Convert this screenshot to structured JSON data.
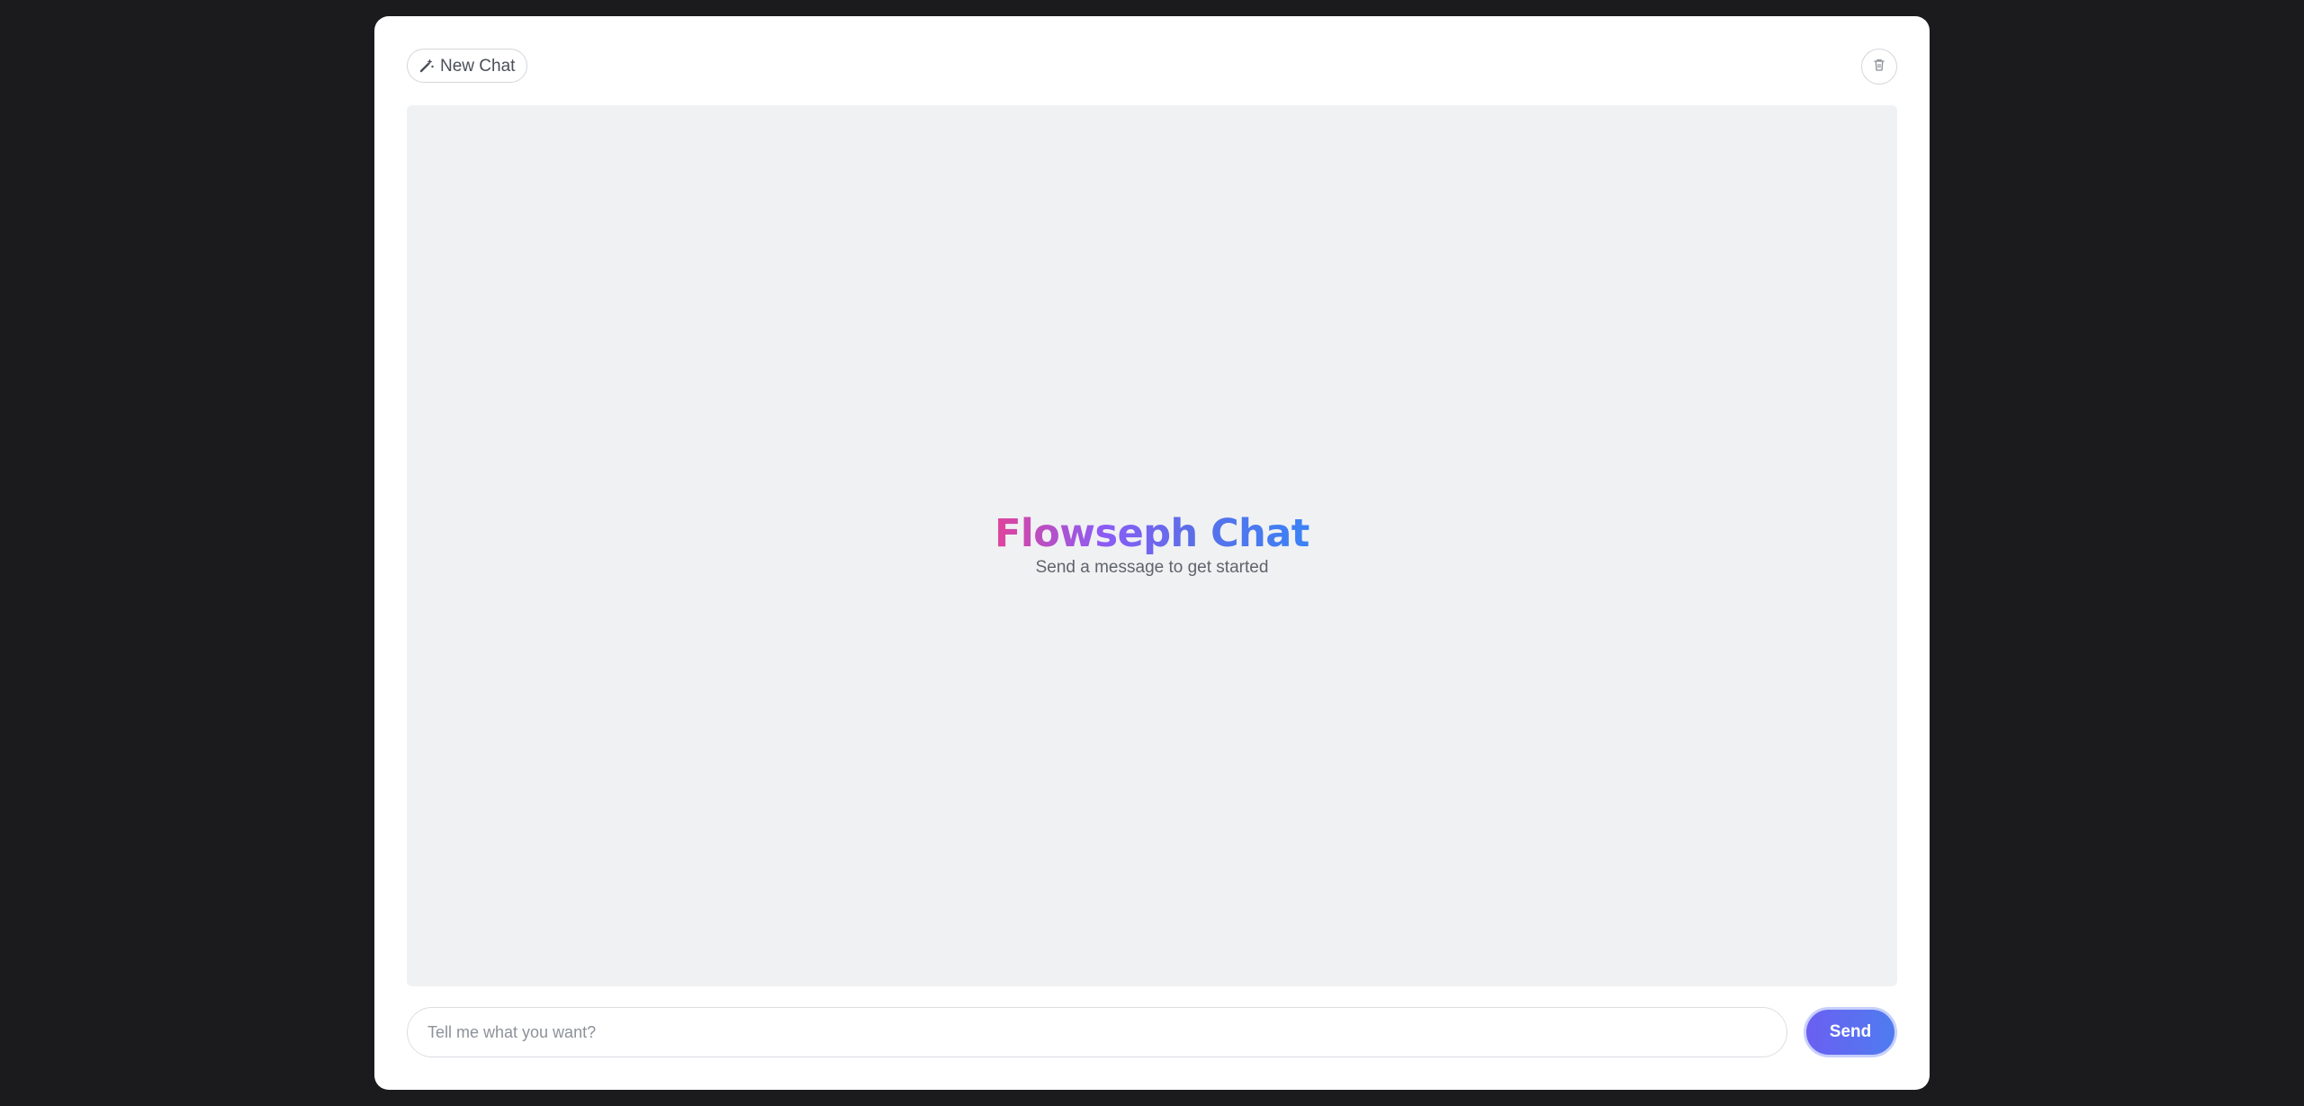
{
  "header": {
    "new_chat_label": "New Chat",
    "new_chat_icon": "magic-wand-icon",
    "clear_icon": "trash-icon"
  },
  "chat": {
    "title": "Flowseph Chat",
    "subtitle": "Send a message to get started"
  },
  "composer": {
    "placeholder": "Tell me what you want?",
    "value": "",
    "send_label": "Send"
  },
  "colors": {
    "background": "#1b1b1d",
    "card": "#ffffff",
    "chat_area": "#f0f1f3",
    "title_gradient": [
      "#e0439a",
      "#8b5cf6",
      "#3b82f6"
    ],
    "send_button": "#5b6ef0"
  }
}
